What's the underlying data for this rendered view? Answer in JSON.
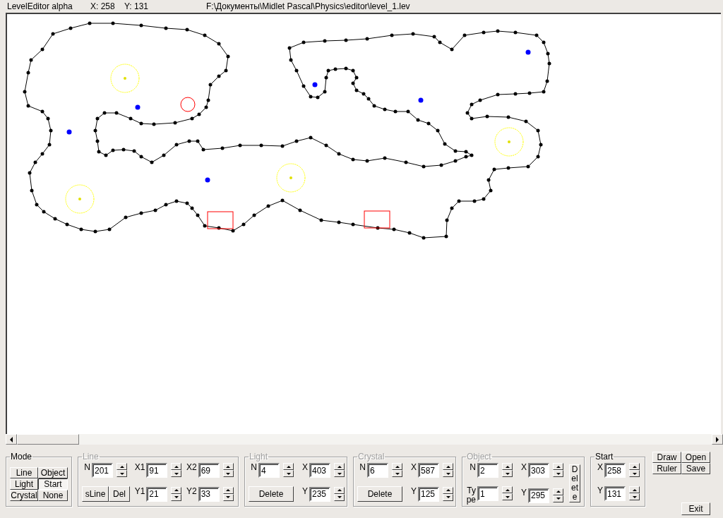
{
  "title_bar": {
    "app_title": "LevelEditor alpha",
    "x_readout": "X: 258",
    "y_readout": "Y: 131",
    "file_path": "F:\\Документы\\Midlet Pascal\\Physics\\editor\\level_1.lev"
  },
  "mode": {
    "label": "Mode",
    "buttons": [
      {
        "label": "Line",
        "selected": false
      },
      {
        "label": "Object",
        "selected": false
      },
      {
        "label": "Light",
        "selected": false
      },
      {
        "label": "Start",
        "selected": true
      },
      {
        "label": "Crystal",
        "selected": false
      },
      {
        "label": "None",
        "selected": false
      }
    ]
  },
  "groups": [
    {
      "label": "Line",
      "disabled": true,
      "kind": "line",
      "fields": [
        {
          "label": "N",
          "value": "201"
        },
        {
          "label": "X1",
          "value": "91"
        },
        {
          "label": "X2",
          "value": "69"
        },
        {
          "label": "Y1",
          "value": "21"
        },
        {
          "label": "Y2",
          "value": "33"
        }
      ],
      "buttons": [
        "sLine",
        "Del"
      ]
    },
    {
      "label": "Light",
      "disabled": true,
      "kind": "light",
      "fields": [
        {
          "label": "N",
          "value": "4"
        },
        {
          "label": "X",
          "value": "403"
        },
        {
          "label": "Y",
          "value": "235"
        }
      ],
      "buttons": [
        "Delete"
      ]
    },
    {
      "label": "Crystal",
      "disabled": true,
      "kind": "light",
      "fields": [
        {
          "label": "N",
          "value": "6"
        },
        {
          "label": "X",
          "value": "587"
        },
        {
          "label": "Y",
          "value": "125"
        }
      ],
      "buttons": [
        "Delete"
      ]
    },
    {
      "label": "Object",
      "disabled": true,
      "kind": "object",
      "fields": [
        {
          "label": "N",
          "value": "2"
        },
        {
          "label": "X",
          "value": "303"
        },
        {
          "label": "Type",
          "value": "1"
        },
        {
          "label": "Y",
          "value": "295"
        }
      ],
      "buttons": [
        "Delete"
      ]
    },
    {
      "label": "Start",
      "disabled": false,
      "kind": "start",
      "fields": [
        {
          "label": "X",
          "value": "258"
        },
        {
          "label": "Y",
          "value": "131"
        }
      ]
    }
  ],
  "actions": [
    "Draw",
    "Open",
    "Ruler",
    "Save"
  ],
  "exit_button": "Exit"
}
